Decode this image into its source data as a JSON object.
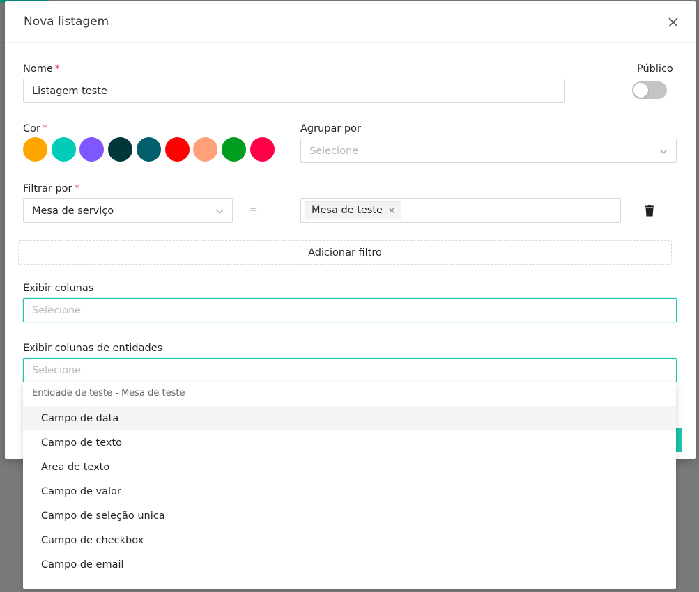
{
  "modal": {
    "title": "Nova listagem",
    "name_label": "Nome",
    "name_value": "Listagem teste",
    "public_label": "Público",
    "public_on": false,
    "color_label": "Cor",
    "group_label": "Agrupar por",
    "group_placeholder": "Selecione",
    "filter_label": "Filtrar por",
    "filter_field": "Mesa de serviço",
    "filter_operator": "=",
    "filter_value_tag": "Mesa de teste",
    "add_filter_label": "Adicionar filtro",
    "columns_label": "Exibir colunas",
    "columns_placeholder": "Selecione",
    "entity_columns_label": "Exibir colunas de entidades",
    "entity_columns_placeholder": "Selecione",
    "required_mark": "*"
  },
  "colors": [
    "#ffa500",
    "#00cdb8",
    "#7e57ff",
    "#00373a",
    "#005f6b",
    "#ff0000",
    "#ffa07a",
    "#009e1e",
    "#ff0048"
  ],
  "dropdown": {
    "group_title": "Entidade de teste - Mesa de teste",
    "items": [
      "Campo de data",
      "Campo de texto",
      "Area de texto",
      "Campo de valor",
      "Campo de seleção unica",
      "Campo de checkbox",
      "Campo de email"
    ],
    "active_index": 0
  },
  "icons": {
    "close": "close-icon",
    "chevron": "chevron-down-icon",
    "tag_remove": "close-icon",
    "delete": "trash-icon"
  },
  "theme": {
    "accent": "#1fc3ad",
    "required": "#e8336b"
  }
}
